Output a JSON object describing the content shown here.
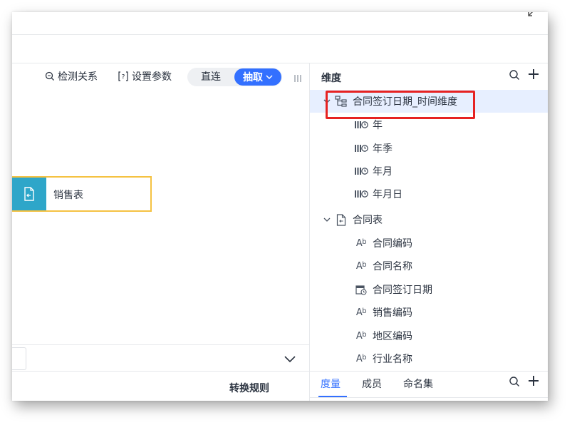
{
  "toolbar": {
    "detect_relation": "检测关系",
    "set_params": "设置参数",
    "mode_direct": "直连",
    "mode_extract": "抽取"
  },
  "canvas": {
    "node_label": "销售表"
  },
  "dimension_panel": {
    "title": "维度",
    "time_dimension": "合同签订日期_时间维度",
    "time_levels": [
      "年",
      "年季",
      "年月",
      "年月日"
    ],
    "table_name": "合同表",
    "fields": [
      {
        "label": "合同编码",
        "type": "text"
      },
      {
        "label": "合同名称",
        "type": "text"
      },
      {
        "label": "合同签订日期",
        "type": "date"
      },
      {
        "label": "销售编码",
        "type": "text"
      },
      {
        "label": "地区编码",
        "type": "text"
      },
      {
        "label": "行业名称",
        "type": "text"
      }
    ]
  },
  "bottom": {
    "rule_label": "转换规则",
    "tabs": [
      "度量",
      "成员",
      "命名集"
    ]
  },
  "colors": {
    "accent": "#3370ff",
    "node_icon_bg": "#2ea6c9",
    "node_border": "#f5c242",
    "highlight": "#e62222",
    "selected_row": "#e7efff"
  }
}
